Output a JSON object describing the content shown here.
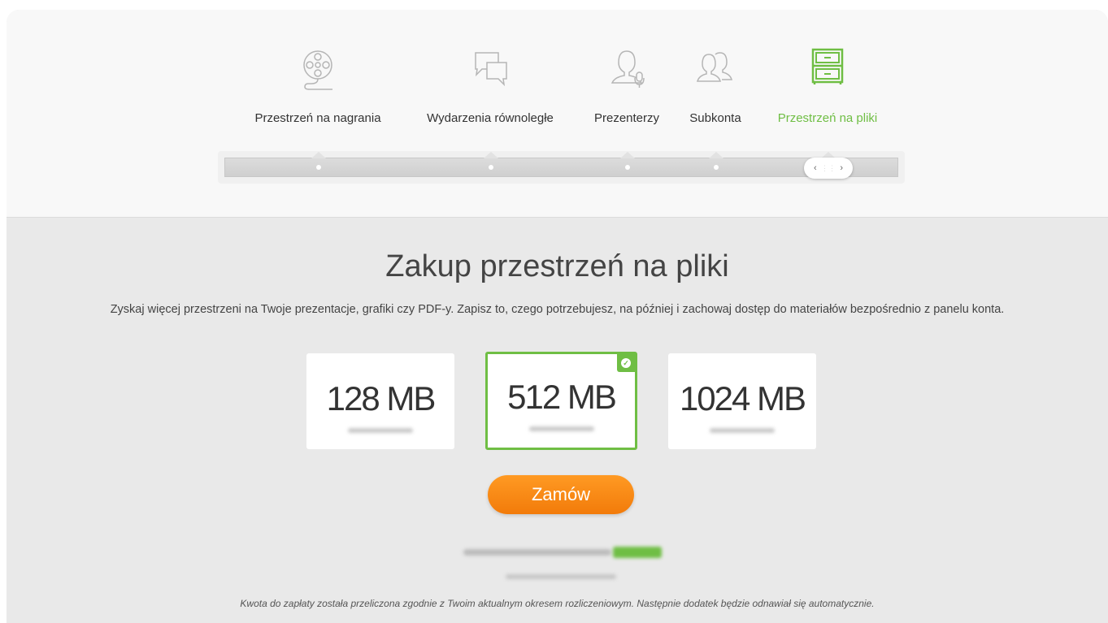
{
  "tabs": [
    {
      "label": "Przestrzeń na nagrania",
      "icon": "film-reel-icon",
      "active": false
    },
    {
      "label": "Wydarzenia równoległe",
      "icon": "chat-bubbles-icon",
      "active": false
    },
    {
      "label": "Prezenterzy",
      "icon": "presenter-microphone-icon",
      "active": false
    },
    {
      "label": "Subkonta",
      "icon": "users-icon",
      "active": false
    },
    {
      "label": "Przestrzeń na pliki",
      "icon": "file-cabinet-icon",
      "active": true
    }
  ],
  "colors": {
    "accent": "#6fbe44",
    "order": "#f7890f"
  },
  "main": {
    "title": "Zakup przestrzeń na pliki",
    "subtitle": "Zyskaj więcej przestrzeni na Twoje prezentacje, grafiki czy PDF-y. Zapisz to, czego potrzebujesz, na później i zachowaj dostęp do materiałów bezpośrednio z panelu konta.",
    "packages": [
      {
        "size": "128 MB",
        "selected": false
      },
      {
        "size": "512 MB",
        "selected": true
      },
      {
        "size": "1024 MB",
        "selected": false
      }
    ],
    "order_label": "Zamów",
    "footnote": "Kwota do zapłaty została przeliczona zgodnie z Twoim aktualnym okresem rozliczeniowym. Następnie dodatek będzie odnawiał się automatycznie."
  }
}
